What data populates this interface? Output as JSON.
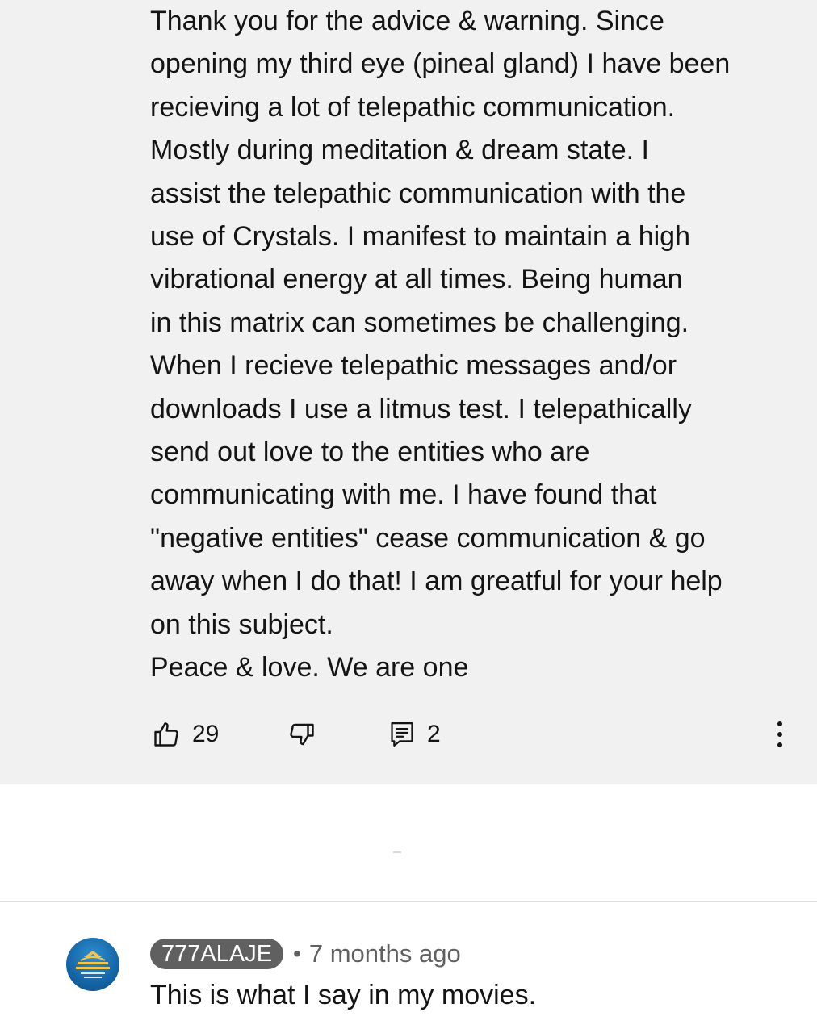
{
  "comment": {
    "lines": [
      "Thank you for the advice & warning. Since",
      "opening my third eye (pineal gland) I have been",
      "recieving a lot of telepathic communication.",
      "Mostly during meditation & dream state. I",
      "assist the telepathic communication with the",
      "use of Crystals. I manifest to maintain  a high",
      "vibrational energy at all times. Being human",
      "in this matrix can sometimes be challenging.",
      "When I recieve telepathic messages and/or",
      "downloads I use a litmus test. I telepathically",
      "send out love to the entities who are",
      "communicating with me. I have found that",
      "\"negative entities\" cease communication & go",
      "away when I do that! I am greatful for your  help",
      "on this subject.",
      "Peace & love. We are one"
    ],
    "actions": {
      "like_count": "29",
      "reply_count": "2"
    }
  },
  "reply": {
    "author": "777ALAJE",
    "separator": "•",
    "timestamp": "7 months ago",
    "text": "This is what I say in my movies."
  },
  "colors": {
    "card_background": "#f1f1f1",
    "page_background": "#ffffff",
    "author_chip": "#606060",
    "text_primary": "#141414",
    "text_secondary": "#606060",
    "avatar_blue": "#1565a6"
  },
  "icons": {
    "like": "thumbs-up-icon",
    "dislike": "thumbs-down-icon",
    "reply": "comment-icon",
    "menu": "more-vertical-icon"
  }
}
